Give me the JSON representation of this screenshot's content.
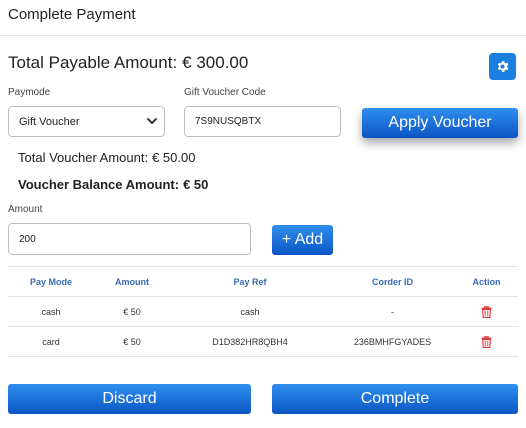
{
  "header": {
    "title": "Complete Payment"
  },
  "summary": {
    "total_label": "Total Payable Amount:",
    "total_value": "€ 300.00"
  },
  "form": {
    "paymode_label": "Paymode",
    "paymode_value": "Gift Voucher",
    "voucher_code_label": "Gift Voucher Code",
    "voucher_code_value": "7S9NUSQBTX",
    "apply_button": "Apply Voucher",
    "voucher_total_label": "Total Voucher Amount:",
    "voucher_total_value": "€ 50.00",
    "voucher_balance_label": "Voucher Balance Amount:",
    "voucher_balance_value": "€ 50",
    "amount_label": "Amount",
    "amount_value": "200",
    "add_button": "+ Add"
  },
  "table": {
    "headers": [
      "Pay Mode",
      "Amount",
      "Pay Ref",
      "Corder ID",
      "Action"
    ],
    "rows": [
      {
        "pay_mode": "cash",
        "amount": "€ 50",
        "pay_ref": "cash",
        "corder_id": "-"
      },
      {
        "pay_mode": "card",
        "amount": "€ 50",
        "pay_ref": "D1D382HR8QBH4",
        "corder_id": "236BMHFGYADES"
      }
    ]
  },
  "footer": {
    "discard_button": "Discard",
    "complete_button": "Complete"
  },
  "icons": {
    "settings": "gear-icon",
    "dropdown": "chevron-down-icon",
    "delete": "trash-icon"
  },
  "colors": {
    "accent": "#1a7fe0",
    "button_gradient_top": "#2f8fee",
    "button_gradient_bottom": "#0b55c4",
    "table_header": "#3a6ab5",
    "delete": "#e0363b"
  }
}
